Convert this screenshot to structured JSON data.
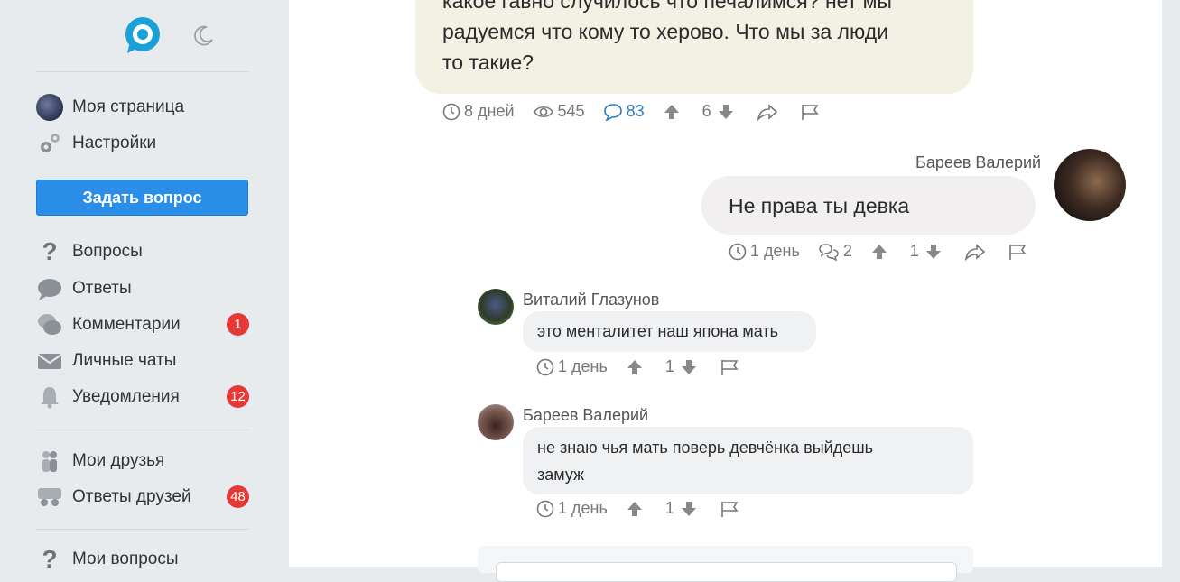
{
  "sidebar": {
    "logo_icon": "site-logo-icon",
    "theme_icon": "moon-icon",
    "items": [
      {
        "label": "Моя страница",
        "icon": "avatar"
      },
      {
        "label": "Настройки",
        "icon": "gears-icon"
      },
      {
        "label": "Вопросы",
        "icon": "question-icon"
      },
      {
        "label": "Ответы",
        "icon": "speech-bubble-icon"
      },
      {
        "label": "Комментарии",
        "icon": "comments-icon",
        "badge": "1"
      },
      {
        "label": "Личные чаты",
        "icon": "envelope-icon"
      },
      {
        "label": "Уведомления",
        "icon": "bell-icon",
        "badge": "12"
      },
      {
        "label": "Мои друзья",
        "icon": "friends-icon"
      },
      {
        "label": "Ответы друзей",
        "icon": "friends-answers-icon",
        "badge": "48"
      },
      {
        "label": "Мои вопросы",
        "icon": "question-icon"
      }
    ],
    "ask_button": "Задать вопрос"
  },
  "top_post": {
    "text_lines": [
      "какое гавно случилось что печалимся? нет мы",
      "радуемся что кому то херово. Что мы за люди",
      "то такие?"
    ],
    "time": "8 дней",
    "views": "545",
    "comments": "83",
    "votes": "6"
  },
  "reply": {
    "author": "Бареев Валерий",
    "text": "Не права ты девка",
    "time": "1 день",
    "replies": "2",
    "votes": "1"
  },
  "sub_comments": [
    {
      "author": "Виталий Глазунов",
      "text": "это менталитет наш япона мать",
      "time": "1 день",
      "votes": "1"
    },
    {
      "author": "Бареев Валерий",
      "text_lines": [
        "не знаю чья мать поверь девчёнка выйдешь",
        "замуж"
      ],
      "time": "1 день",
      "votes": "1"
    }
  ],
  "colors": {
    "accent": "#2a8ee8",
    "badge": "#e53935",
    "post_bubble": "#f3f1e3",
    "link": "#2a7bc8"
  }
}
